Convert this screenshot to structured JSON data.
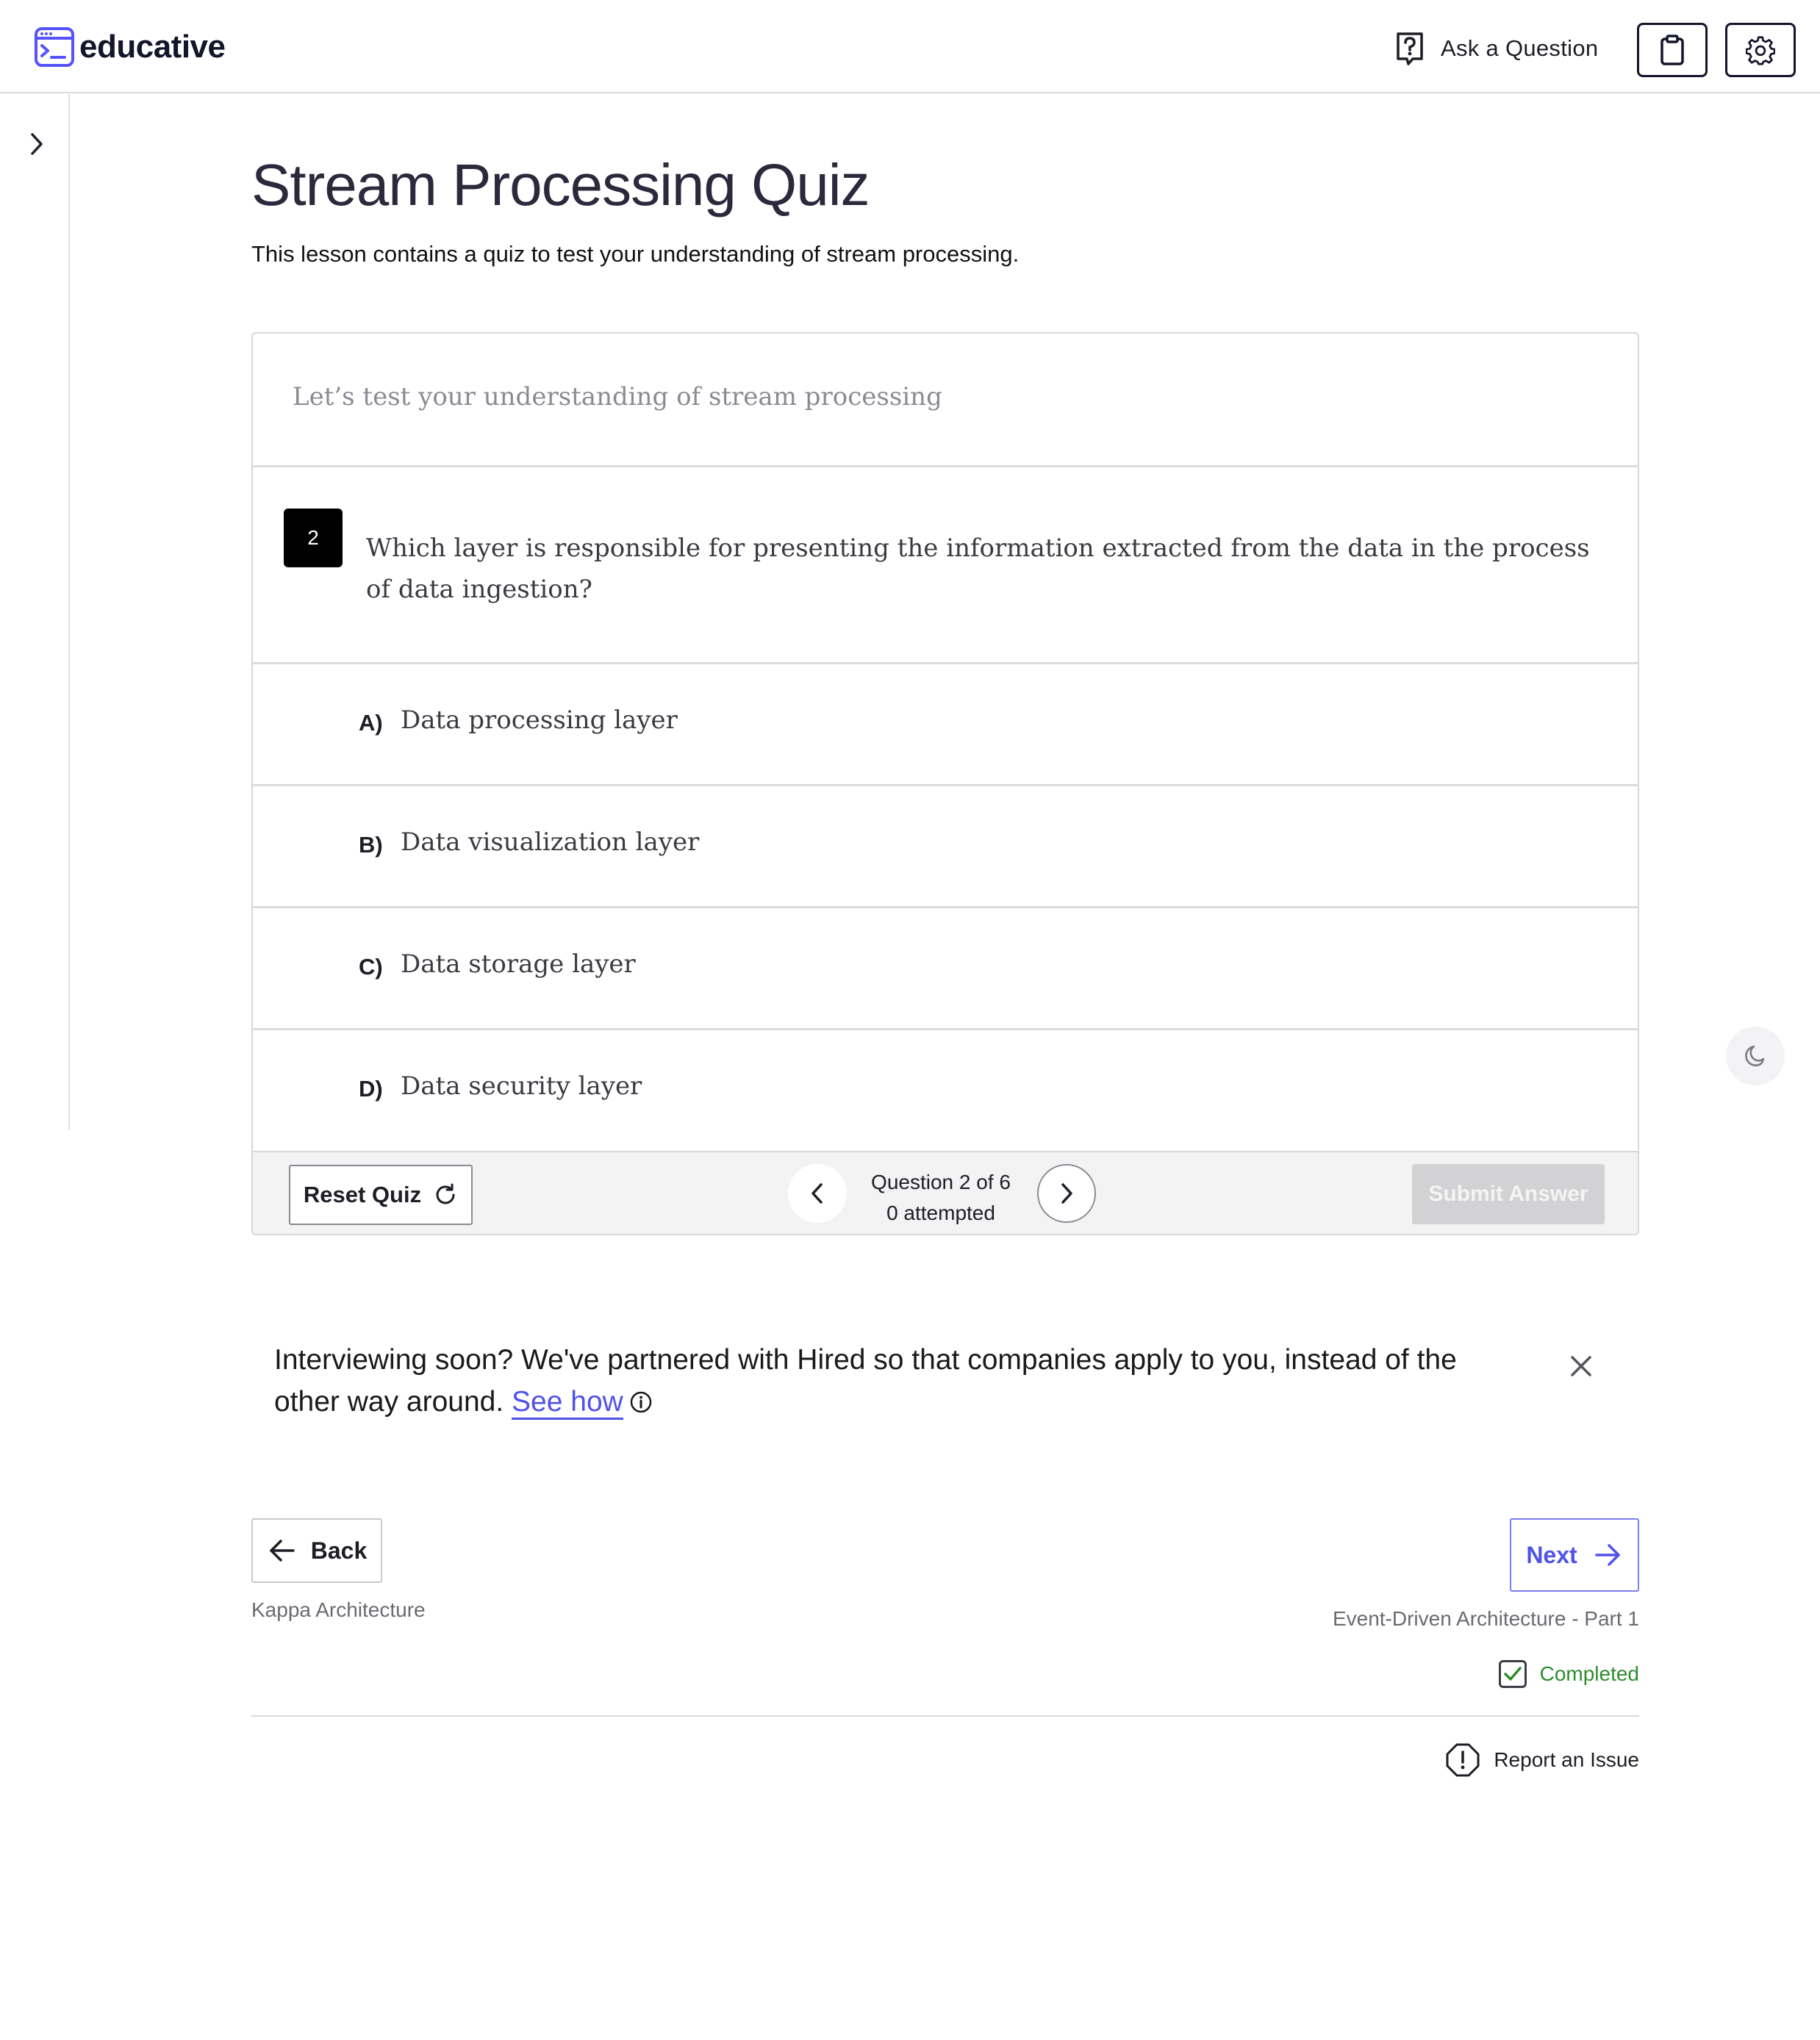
{
  "header": {
    "logo_text": "educative",
    "ask_question_label": "Ask a Question",
    "brand_color": "#5553ff"
  },
  "lesson": {
    "title": "Stream Processing Quiz",
    "subtitle": "This lesson contains a quiz to test your understanding of stream processing."
  },
  "quiz": {
    "intro": "Let’s test your understanding of stream processing",
    "question_number": "2",
    "question_text": "Which layer is responsible for presenting the information extracted from the data in the process of data ingestion?",
    "options": [
      {
        "letter": "A)",
        "text": "Data processing layer"
      },
      {
        "letter": "B)",
        "text": "Data visualization layer"
      },
      {
        "letter": "C)",
        "text": "Data storage layer"
      },
      {
        "letter": "D)",
        "text": "Data security layer"
      }
    ],
    "reset_label": "Reset Quiz",
    "progress_label": "Question 2 of 6",
    "attempted_label": "0 attempted",
    "submit_label": "Submit Answer"
  },
  "promo": {
    "text": "Interviewing soon? We've partnered with Hired so that companies apply to you, instead of the other way around.",
    "link_label": "See how"
  },
  "navigation": {
    "back_label": "Back",
    "back_lesson": "Kappa Architecture",
    "next_label": "Next",
    "next_lesson": "Event-Driven Architecture - Part 1",
    "completed_label": "Completed",
    "report_label": "Report an Issue"
  }
}
